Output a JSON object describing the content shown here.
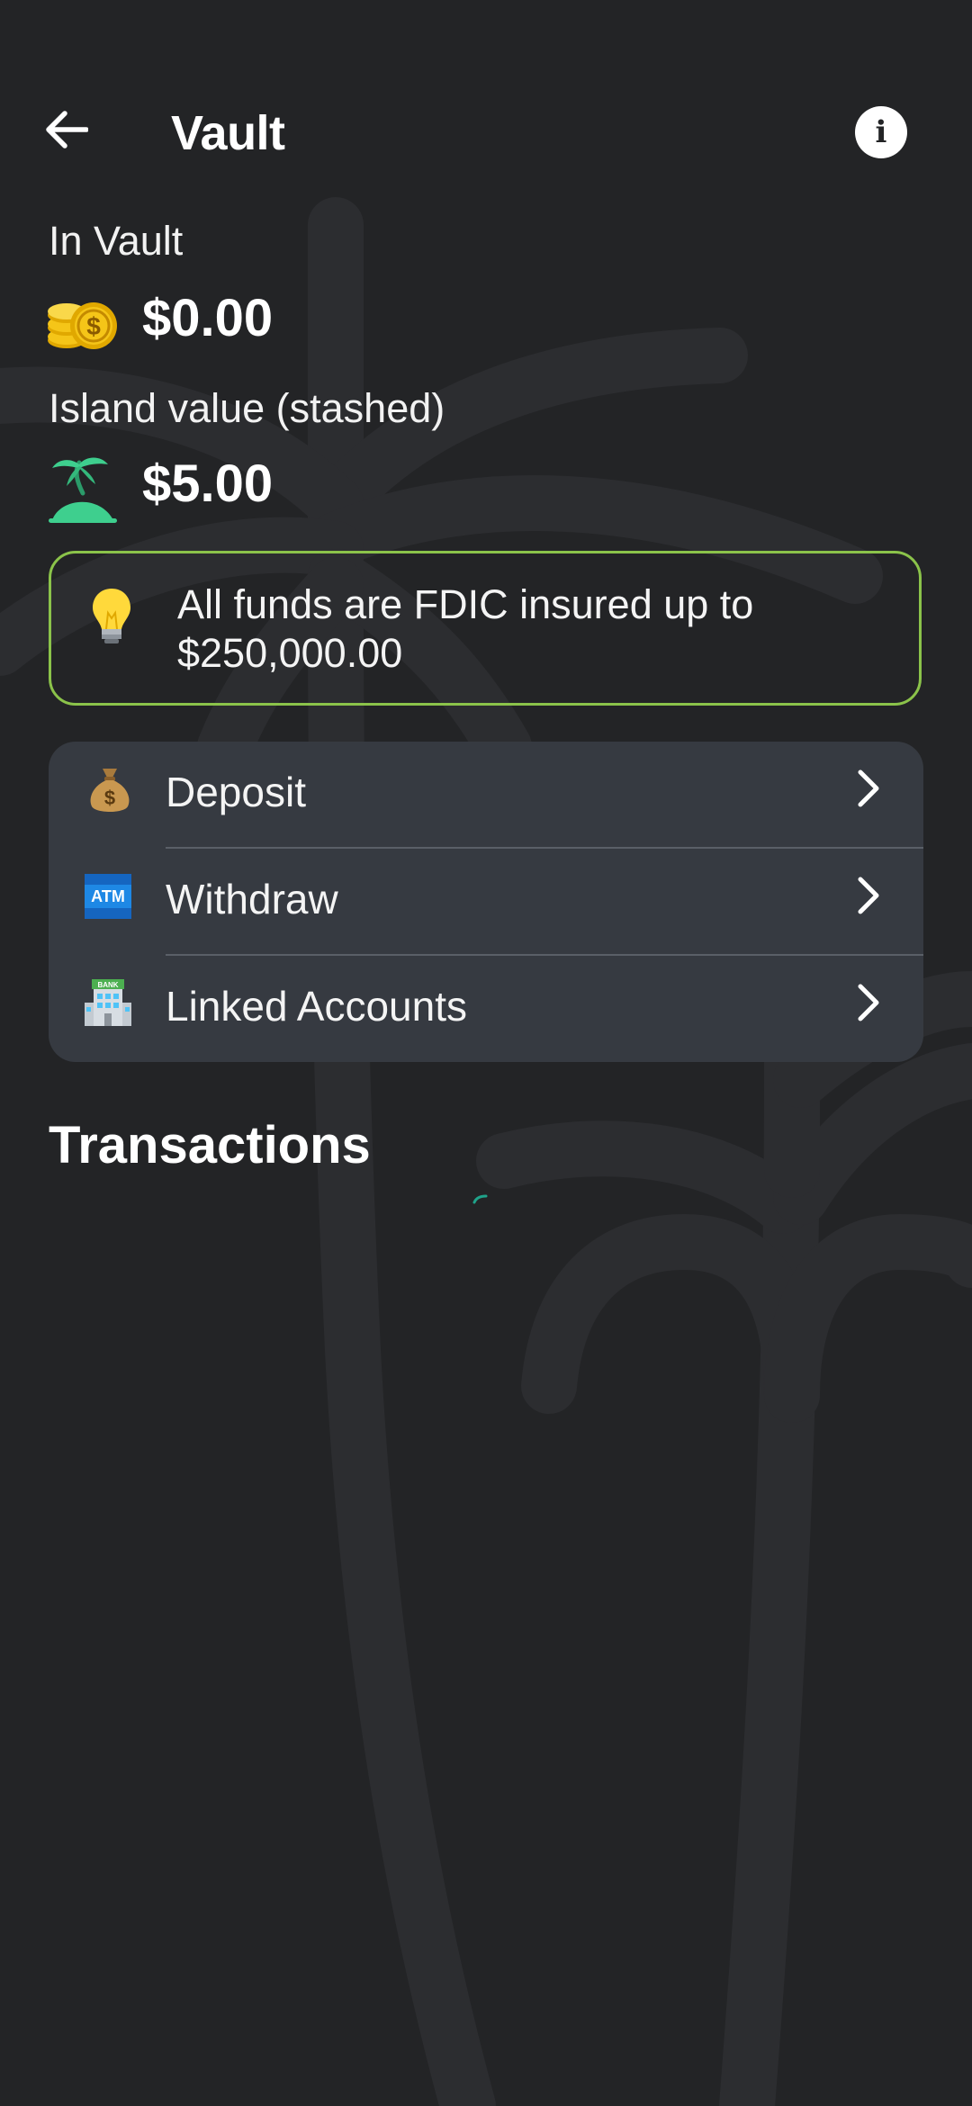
{
  "header": {
    "title": "Vault",
    "back_icon": "arrow-left-icon",
    "info_icon": "info-icon"
  },
  "in_vault": {
    "label": "In Vault",
    "amount": "$0.00",
    "icon": "coins-icon"
  },
  "island_value": {
    "label": "Island value (stashed)",
    "amount": "$5.00",
    "icon": "island-icon"
  },
  "fdic_notice": {
    "icon": "lightbulb-icon",
    "text": "All funds are FDIC insured up to $250,000.00",
    "border_color": "#8bc34a"
  },
  "menu": {
    "items": [
      {
        "label": "Deposit",
        "icon": "money-bag-icon"
      },
      {
        "label": "Withdraw",
        "icon": "atm-icon"
      },
      {
        "label": "Linked Accounts",
        "icon": "bank-icon"
      }
    ]
  },
  "transactions": {
    "title": "Transactions",
    "loading_indicator_color": "#1fa38a"
  },
  "colors": {
    "background": "#232426",
    "card": "#363a41",
    "accent_green": "#8bc34a",
    "island_green": "#3ecf8e",
    "coin_gold": "#f5c518"
  }
}
